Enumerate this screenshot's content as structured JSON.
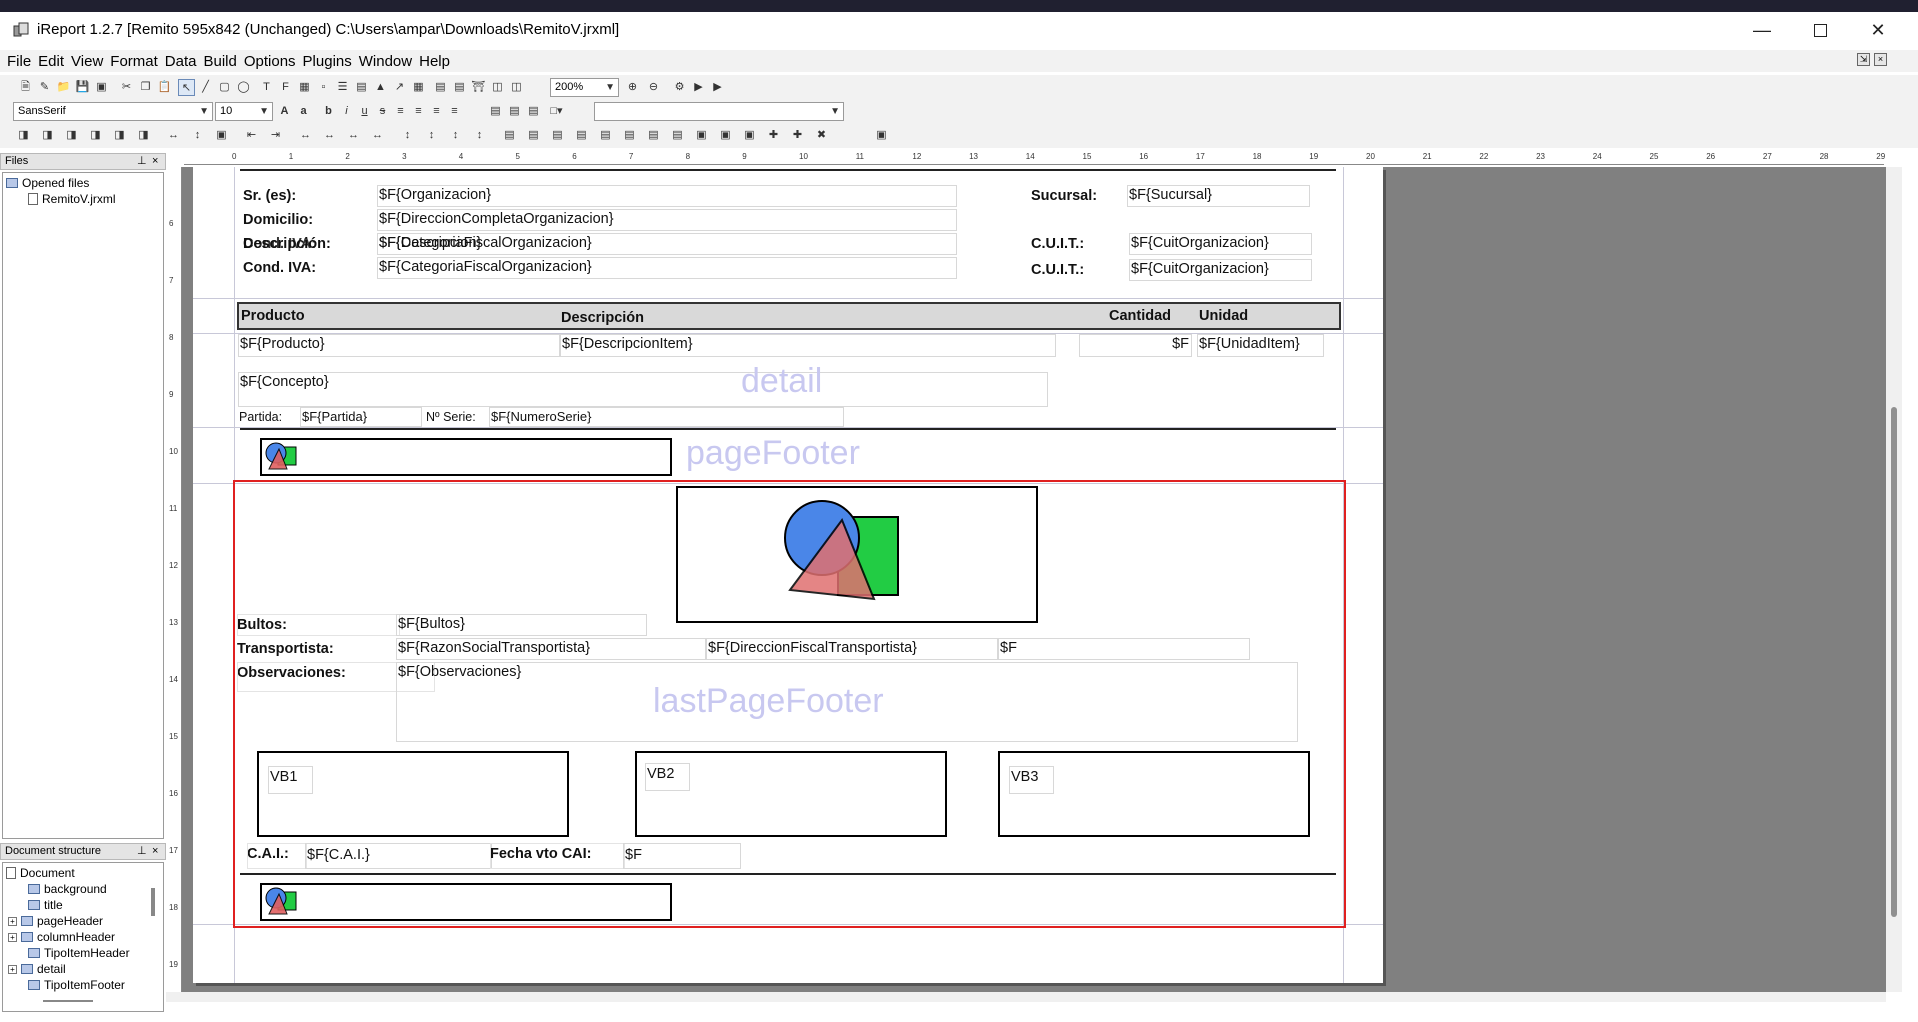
{
  "window": {
    "title": "iReport 1.2.7  [Remito 595x842 (Unchanged) C:\\Users\\ampar\\Downloads\\RemitoV.jrxml]",
    "minimize_icon": "minimize-icon",
    "maximize_icon": "maximize-icon",
    "close_icon": "close-icon"
  },
  "menu": [
    "File",
    "Edit",
    "View",
    "Format",
    "Data",
    "Build",
    "Options",
    "Plugins",
    "Window",
    "Help"
  ],
  "toolbar": {
    "zoom": "200%",
    "font_name": "SansSerif",
    "font_size": "10",
    "style_combo": ""
  },
  "files_panel": {
    "title": "Files",
    "root": "Opened files",
    "items": [
      "RemitoV.jrxml"
    ]
  },
  "structure_panel": {
    "title": "Document structure",
    "root": "Document",
    "items": [
      "background",
      "title",
      "pageHeader",
      "columnHeader",
      "TipoItemHeader",
      "detail",
      "TipoItemFooter"
    ]
  },
  "ruler": {
    "h_marks": [
      "0",
      "1",
      "2",
      "3",
      "4",
      "5",
      "6",
      "7",
      "8",
      "9",
      "10",
      "11",
      "12",
      "13",
      "14",
      "15",
      "16",
      "17",
      "18",
      "19",
      "20",
      "21",
      "22",
      "23",
      "24",
      "25",
      "26",
      "27",
      "28",
      "29"
    ],
    "v_marks": [
      "6",
      "7",
      "8",
      "9",
      "10",
      "11",
      "12",
      "13",
      "14",
      "15",
      "16",
      "17",
      "18",
      "19"
    ]
  },
  "report": {
    "header": {
      "sr_label": "Sr. (es):",
      "sr_field": "$F{Organizacion}",
      "domicilio_label": "Domicilio:",
      "domicilio_field": "$F{DireccionCompletaOrganizacion}",
      "descripcion_label": "Descripción:",
      "descripcion_field": "$F{Descripcion}",
      "cond_overlap_label": "Cond. IVA:",
      "cond_overlap_field": "$F{CategoriaFiscalOrganizacion}",
      "cond_label": "Cond. IVA:",
      "cond_field": "$F{CategoriaFiscalOrganizacion}",
      "sucursal_label": "Sucursal:",
      "sucursal_field": "$F{Sucursal}",
      "cuit_label_1": "C.U.I.T.:",
      "cuit_field_1": "$F{CuitOrganizacion}",
      "cuit_label_2": "C.U.I.T.:",
      "cuit_field_2": "$F{CuitOrganizacion}"
    },
    "column_header": {
      "producto": "Producto",
      "descripcion": "Descripción",
      "cantidad": "Cantidad",
      "unidad": "Unidad"
    },
    "detail": {
      "producto": "$F{Producto}",
      "descripcion_item": "$F{DescripcionItem}",
      "cantidad": "$F",
      "unidad_item": "$F{UnidadItem}",
      "concepto": "$F{Concepto}",
      "band_name": "detail",
      "partida_label": "Partida:",
      "partida_field": "$F{Partida}",
      "serie_label": "Nº Serie:",
      "serie_field": "$F{NumeroSerie}"
    },
    "page_footer": {
      "band_name": "pageFooter"
    },
    "last_page_footer": {
      "band_name": "lastPageFooter",
      "bultos_label": "Bultos:",
      "bultos_field": "$F{Bultos}",
      "transportista_label": "Transportista:",
      "transportista_field": "$F{RazonSocialTransportista}",
      "direccion_transp_field": "$F{DireccionFiscalTransportista}",
      "transp_extra_field": "$F",
      "observaciones_label": "Observaciones:",
      "observaciones_field": "$F{Observaciones}",
      "vb1": "VB1",
      "vb2": "VB2",
      "vb3": "VB3",
      "cai_label": "C.A.I.:",
      "cai_field": "$F{C.A.I.}",
      "fecha_cai_label": "Fecha vto CAI:",
      "fecha_cai_field": "$F"
    }
  },
  "colors": {
    "selection": "#e02020",
    "band_label": "#c8c8f0",
    "canvas_bg": "#808080",
    "column_header_bg": "#d9d9d9"
  }
}
